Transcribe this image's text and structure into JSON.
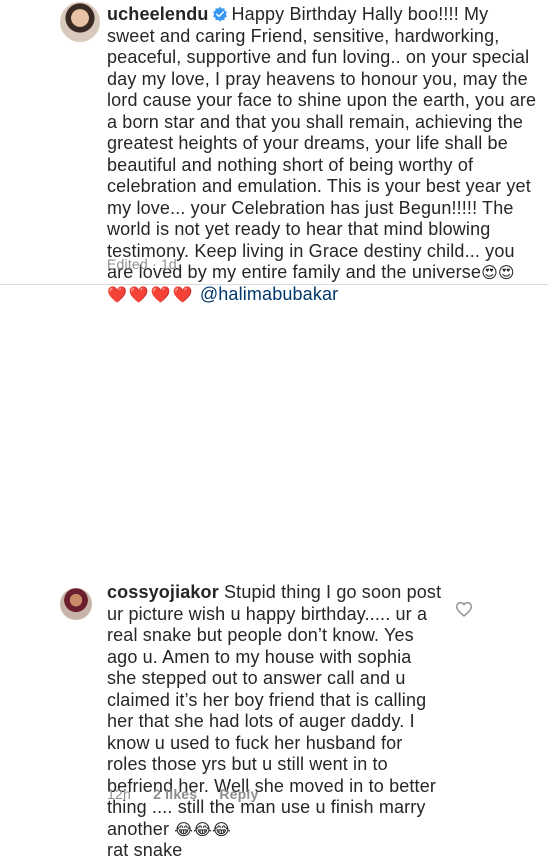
{
  "comment1": {
    "username": "ucheelendu",
    "verified": true,
    "text": "Happy Birthday Hally boo!!!! My sweet and caring Friend, sensitive, hardworking,  peaceful, supportive and fun loving.. on your special day my love, I pray heavens to honour you, may the lord cause your face to shine upon the earth, you are a born star and that you shall remain, achieving the greatest heights of your dreams, your life shall be beautiful and nothing short of being worthy of celebration and emulation. This is your best year yet my love... your Celebration has just Begun!!!!! The world is not yet ready to hear that mind blowing testimony. Keep living in Grace destiny child... you are loved by my entire family and the universe",
    "emoji_after_text": "😍😍",
    "hearts": "❤️❤️❤️❤️",
    "mention": "@halimabubakar",
    "meta": "Edited · 1d"
  },
  "comment2": {
    "username": "cossyojiakor",
    "text": "Stupid thing I go soon post ur picture wish u happy birthday..... ur a real snake but people don’t know. Yes ago u. Amen to my house with sophia she stepped out to answer call and u claimed it’s her boy friend that is calling her that she had lots of auger daddy. I know u used to fuck her husband for roles those yrs but u still went in to befriend her. Well she moved in to better thing .... still the man use u finish marry another",
    "emoji_after_text": "😂😂😂",
    "text_end": "rat snake",
    "time": "12h",
    "likes": "2 likes",
    "reply": "Reply"
  },
  "icons": {
    "verified": "verified-badge-icon",
    "like": "heart-outline-icon"
  },
  "colors": {
    "text": "#262626",
    "meta": "#8e8e8e",
    "mention": "#00376b",
    "verified": "#3897f0",
    "divider": "#dbdbdb"
  }
}
